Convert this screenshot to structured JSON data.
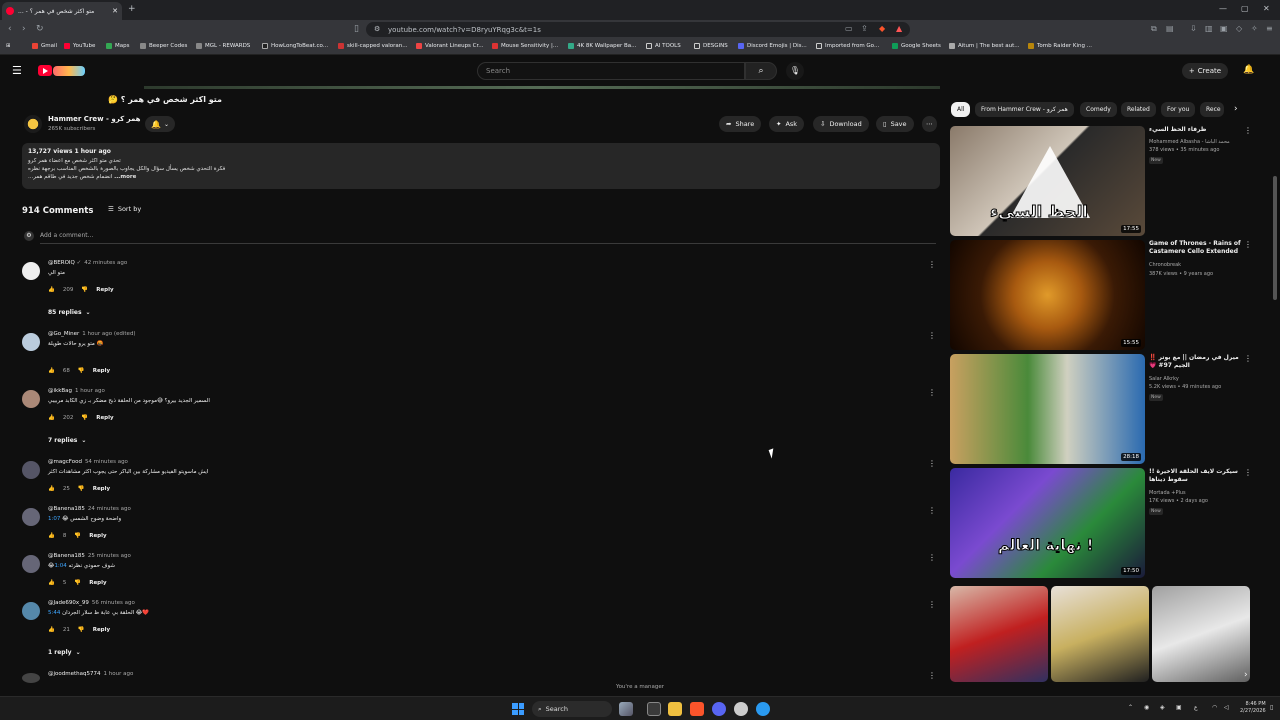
{
  "browser": {
    "tab_title": "متو اكثر شخص في همر ؟ - ...",
    "url": "youtube.com/watch?v=D8ryuYRqg3c&t=1s",
    "bookmarks": [
      "Gmail",
      "YouTube",
      "Maps",
      "Beeper Codes",
      "MGL - REWARDS",
      "HowLongToBeat.co...",
      "skill-capped valoran...",
      "Valorant Lineups Cr...",
      "Mouse Sensitivity |...",
      "4K 8K Wallpaper Ba...",
      "AI TOOLS",
      "DESGINS",
      "Discord Emojis | Dis...",
      "Imported from Go...",
      "Google Sheets",
      "Aitum | The best aut...",
      "Tomb Raider King ..."
    ]
  },
  "header": {
    "search_placeholder": "Search",
    "create_label": "Create"
  },
  "video": {
    "title": "متو اكثر شخص في همر ؟ 🤔",
    "channel_name": "Hammer Crew - همر كرو",
    "subscribers": "265K subscribers",
    "actions": {
      "share": "Share",
      "ask": "Ask",
      "download": "Download",
      "save": "Save"
    },
    "stats": "13,727 views  1 hour ago",
    "desc_lines": [
      "تحدي متو اكثر شخص مع اعضاء همر كرو",
      "فكرة التحدي شخص يسأل سؤال والكل يجاوب بالصورة بالشخص المناسب برجهة نظره",
      "...انضمام شخص جديد في طاقم همر"
    ],
    "more_label": "...more"
  },
  "comments": {
    "count_label": "914 Comments",
    "sort_label": "Sort by",
    "add_placeholder": "Add a comment...",
    "reply_label": "Reply",
    "items": [
      {
        "user": "@BEROIQ",
        "time": "42 minutes ago",
        "text": "متو الي",
        "likes": "209",
        "replies": "85 replies"
      },
      {
        "user": "@Go_Miner",
        "time": "1 hour ago (edited)",
        "text": "متو يرو حالات طويلة 🤬",
        "likes": "68",
        "replies": ""
      },
      {
        "user": "@ikkBag",
        "time": "1 hour ago",
        "text": "السمير الجديد بيرو؟ 😅موجود من الحلقة ذبح مضكر بـ زي الكابد مربيبي",
        "likes": "202",
        "replies": "7 replies"
      },
      {
        "user": "@magcFood",
        "time": "54 minutes ago",
        "text": "ايش ماسويتو الفيديو مشاركة بين الباكر حتى يجوب اكثر مشاهدات اكثر",
        "likes": "25",
        "replies": ""
      },
      {
        "user": "@Banena185",
        "time": "24 minutes ago",
        "ts": "1:07",
        "text": "واضحة وضوح الشمس 😂",
        "likes": "8",
        "replies": ""
      },
      {
        "user": "@Banena185",
        "time": "25 minutes ago",
        "ts": "1:04",
        "text": "😂شوف حمودي نظرته",
        "likes": "5",
        "replies": ""
      },
      {
        "user": "@Jade690x_99",
        "time": "56 minutes ago",
        "ts": "5:44",
        "text": "الحلقة بي عابة ظ سلار الجردان 😂❤️",
        "likes": "21",
        "replies": "1 reply"
      },
      {
        "user": "@joodmethaq5774",
        "time": "1 hour ago",
        "text": "",
        "likes": "",
        "replies": ""
      }
    ]
  },
  "sidebar": {
    "chips": [
      "All",
      "From Hammer Crew - همر كرو",
      "Comedy",
      "Related",
      "For you",
      "Rece"
    ],
    "videos": [
      {
        "title": "ظرفاء الحظ السيء",
        "channel": "Mohammed Albasha - محمد الباشا",
        "meta": "378 views • 35 minutes ago",
        "badge": "New",
        "duration": "17:55",
        "thumb_text": "الحظ السيء"
      },
      {
        "title": "Game of Thrones - Rains of Castamere Cello Extended",
        "channel": "Chronobreak",
        "meta": "387K views • 9 years ago",
        "badge": "",
        "duration": "15:55",
        "thumb_text": ""
      },
      {
        "title": "ميرل في رمضان || مع بوتر ‼️ الجيم 97# 💗",
        "channel": "Salar Alkrky",
        "meta": "5.2K views • 49 minutes ago",
        "badge": "New",
        "duration": "28:18",
        "thumb_text": ""
      },
      {
        "title": "سيكرت لايف الحلقة الاخيرة !! سقوط ديناها",
        "channel": "Mortada +Plus",
        "meta": "17K views • 2 days ago",
        "badge": "New",
        "duration": "17:50",
        "thumb_text": "نهاية العالم !"
      }
    ]
  },
  "status": "You're a manager",
  "taskbar": {
    "search_label": "Search",
    "time": "8:46 PM",
    "date": "2/27/2026"
  }
}
